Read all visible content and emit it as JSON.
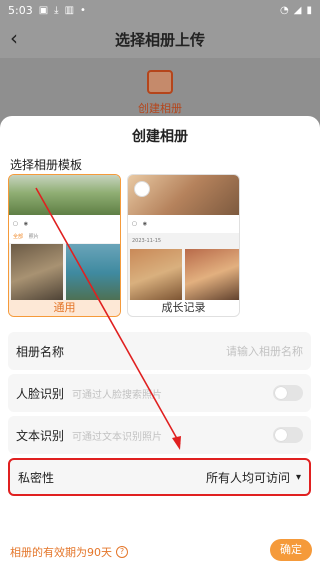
{
  "status_bar": {
    "time": "5:03"
  },
  "header": {
    "title": "选择相册上传"
  },
  "behind": {
    "create_label": "创建相册"
  },
  "sheet": {
    "title": "创建相册",
    "template_label": "选择相册模板",
    "templates": [
      {
        "caption": "通用",
        "selected": true,
        "tab1": "全部",
        "tab2": "照片"
      },
      {
        "caption": "成长记录",
        "selected": false,
        "date1": "2023-11-15",
        "date2": "2023-10-23"
      }
    ],
    "fields": {
      "album_name": {
        "label": "相册名称",
        "placeholder": "请输入相册名称"
      },
      "face_recognition": {
        "label": "人脸识别",
        "hint": "可通过人脸搜索照片",
        "enabled": false
      },
      "text_recognition": {
        "label": "文本识别",
        "hint": "可通过文本识别照片",
        "enabled": false
      },
      "privacy": {
        "label": "私密性",
        "value": "所有人均可访问"
      }
    },
    "validity_note": "相册的有效期为90天",
    "confirm_label": "确定"
  },
  "colors": {
    "accent": "#f59a3a",
    "highlight_border": "#e02020"
  }
}
